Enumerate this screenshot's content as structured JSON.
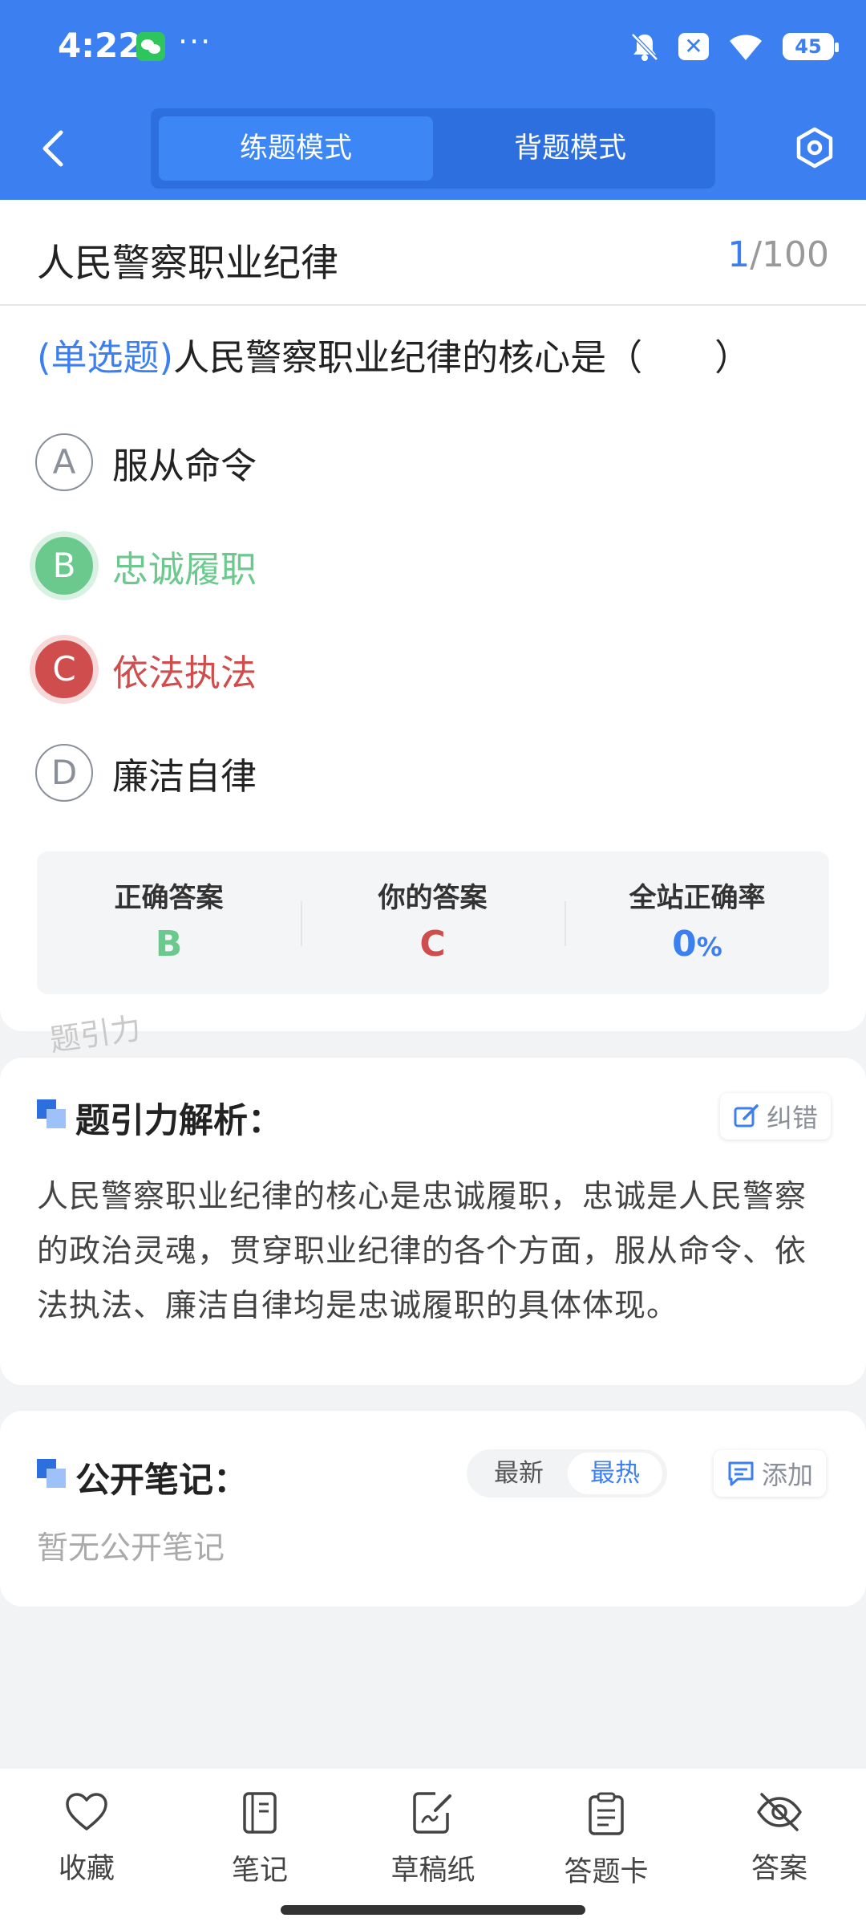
{
  "status_bar": {
    "time": "4:22",
    "dots": "···",
    "battery": "45"
  },
  "nav": {
    "tabs": [
      {
        "label": "练题模式",
        "active": true
      },
      {
        "label": "背题模式",
        "active": false
      }
    ]
  },
  "question": {
    "title": "人民警察职业纪律",
    "counter_current": "1",
    "counter_total": "/100",
    "type": "(单选题)",
    "stem": "人民警察职业纪律的核心是（　　）",
    "options": [
      {
        "letter": "A",
        "text": "服从命令",
        "state": "normal"
      },
      {
        "letter": "B",
        "text": "忠诚履职",
        "state": "correct"
      },
      {
        "letter": "C",
        "text": "依法执法",
        "state": "wrong"
      },
      {
        "letter": "D",
        "text": "廉洁自律",
        "state": "normal"
      }
    ]
  },
  "answer_summary": {
    "correct_label": "正确答案",
    "correct_value": "B",
    "yours_label": "你的答案",
    "yours_value": "C",
    "rate_label": "全站正确率",
    "rate_value": "0",
    "rate_unit": "%"
  },
  "watermark": "题引力",
  "analysis": {
    "title": "题引力解析：",
    "report_button": "纠错",
    "body": "人民警察职业纪律的核心是忠诚履职，忠诚是人民警察的政治灵魂，贯穿职业纪律的各个方面，服从命令、依法执法、廉洁自律均是忠诚履职的具体体现。"
  },
  "notes": {
    "title": "公开笔记：",
    "sort_options": [
      "最新",
      "最热"
    ],
    "active_sort": "最热",
    "add_button": "添加",
    "empty_text": "暂无公开笔记"
  },
  "bottom_tabs": [
    {
      "label": "收藏",
      "icon": "heart-icon"
    },
    {
      "label": "笔记",
      "icon": "notebook-icon"
    },
    {
      "label": "草稿纸",
      "icon": "draft-paper-icon"
    },
    {
      "label": "答题卡",
      "icon": "answer-card-icon"
    },
    {
      "label": "答案",
      "icon": "eye-off-icon"
    }
  ],
  "colors": {
    "primary": "#3b7ff0",
    "correct": "#6cc98d",
    "wrong": "#cf4d4d"
  }
}
